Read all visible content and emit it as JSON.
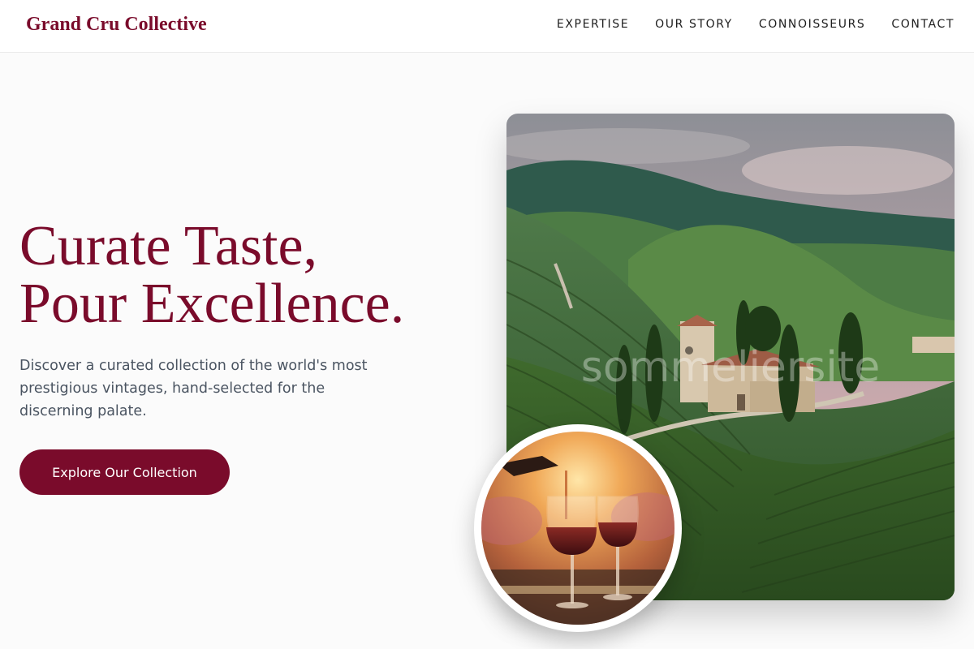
{
  "header": {
    "brand": "Grand Cru Collective",
    "nav": [
      "EXPERTISE",
      "OUR STORY",
      "CONNOISSEURS",
      "CONTACT"
    ]
  },
  "hero": {
    "headline_line1": "Curate Taste,",
    "headline_line2": "Pour Excellence.",
    "description": "Discover a curated collection of the world's most prestigious vintages, hand-selected for the discerning palate.",
    "cta_label": "Explore Our Collection"
  },
  "colors": {
    "accent": "#7a0b2b",
    "text_muted": "#4a5461",
    "background": "#fbfbfb"
  },
  "images": {
    "main": "vineyard-landscape-image",
    "overlay": "wine-glasses-sunset-image",
    "watermark": "sommeliersite"
  }
}
